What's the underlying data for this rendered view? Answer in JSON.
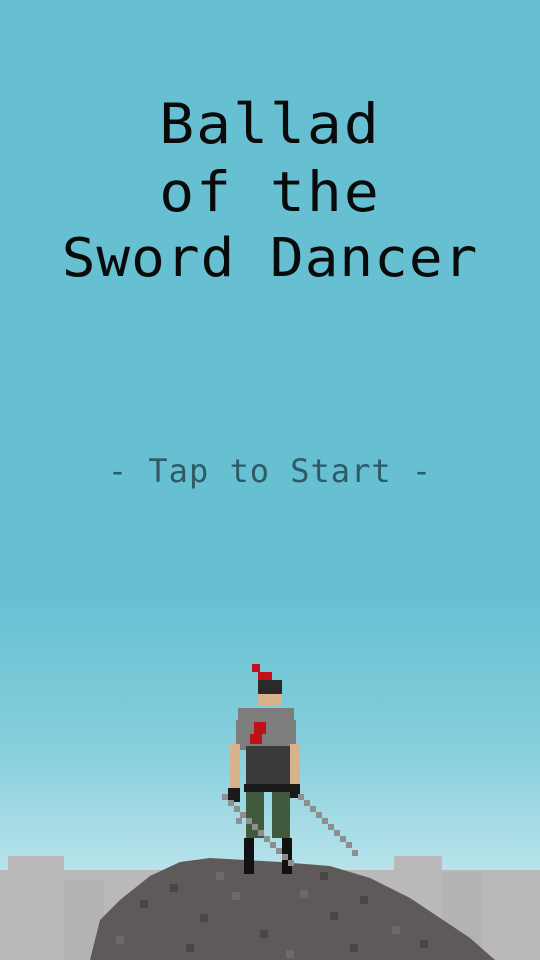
{
  "title": {
    "line1": "Ballad",
    "line2": "of the",
    "line3": "Sword Dancer"
  },
  "prompt": "- Tap to Start -",
  "colors": {
    "sky_top": "#66c0d2",
    "sky_bottom": "#d6f0f3",
    "title_text": "#0a0a0a",
    "prompt_text": "#2f5a66",
    "rock": "#5f5a59",
    "rock_shade": "#4a4646",
    "distant_hills": "#b9b9b9",
    "plume": "#c0101a",
    "armor": "#7d7d7d",
    "skin": "#d8b28a",
    "pants": "#3f5a3c",
    "sword": "#8e8e8e"
  }
}
